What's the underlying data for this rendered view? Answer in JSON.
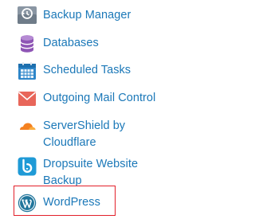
{
  "menu": {
    "items": [
      {
        "label": "Backup Manager",
        "icon": "backup-manager-icon"
      },
      {
        "label": "Databases",
        "icon": "database-icon"
      },
      {
        "label": "Scheduled Tasks",
        "icon": "calendar-icon"
      },
      {
        "label": "Outgoing Mail Control",
        "icon": "envelope-icon"
      },
      {
        "label_line1": "ServerShield by",
        "label_line2": "Cloudflare",
        "icon": "cloudflare-icon"
      },
      {
        "label_line1": "Dropsuite Website",
        "label_line2": "Backup",
        "icon": "dropsuite-icon"
      },
      {
        "label": "WordPress",
        "icon": "wordpress-icon",
        "highlighted": true
      }
    ]
  },
  "colors": {
    "link": "#1b78b8",
    "highlight_border": "#e2202a",
    "mail_icon": "#e8665a",
    "cloudflare_icon": "#f48120",
    "dropsuite_icon": "#1f9ad6",
    "wordpress_icon": "#21759b"
  }
}
